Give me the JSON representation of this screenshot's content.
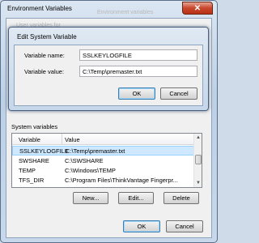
{
  "window": {
    "title": "Environment Variables",
    "close_glyph": "✕",
    "behind_text": [
      "Environment variables",
      "User variables for"
    ]
  },
  "edit_dialog": {
    "title": "Edit System Variable",
    "name_label": "Variable name:",
    "name_value": "SSLKEYLOGFILE",
    "value_label": "Variable value:",
    "value_value": "C:\\Temp\\premaster.txt",
    "ok_label": "OK",
    "cancel_label": "Cancel"
  },
  "system_variables": {
    "title": "System variables",
    "columns": [
      "Variable",
      "Value"
    ],
    "rows": [
      {
        "name": "SSLKEYLOGFILE",
        "value": "C:\\Temp\\premaster.txt"
      },
      {
        "name": "SWSHARE",
        "value": "C:\\SWSHARE"
      },
      {
        "name": "TEMP",
        "value": "C:\\Windows\\TEMP"
      },
      {
        "name": "TFS_DIR",
        "value": "C:\\Program Files\\ThinkVantage Fingerpr..."
      }
    ],
    "new_label": "New...",
    "edit_label": "Edit...",
    "delete_label": "Delete"
  },
  "footer": {
    "ok_label": "OK",
    "cancel_label": "Cancel"
  },
  "icons": {
    "scroll_up": "▲",
    "scroll_down": "▼"
  }
}
